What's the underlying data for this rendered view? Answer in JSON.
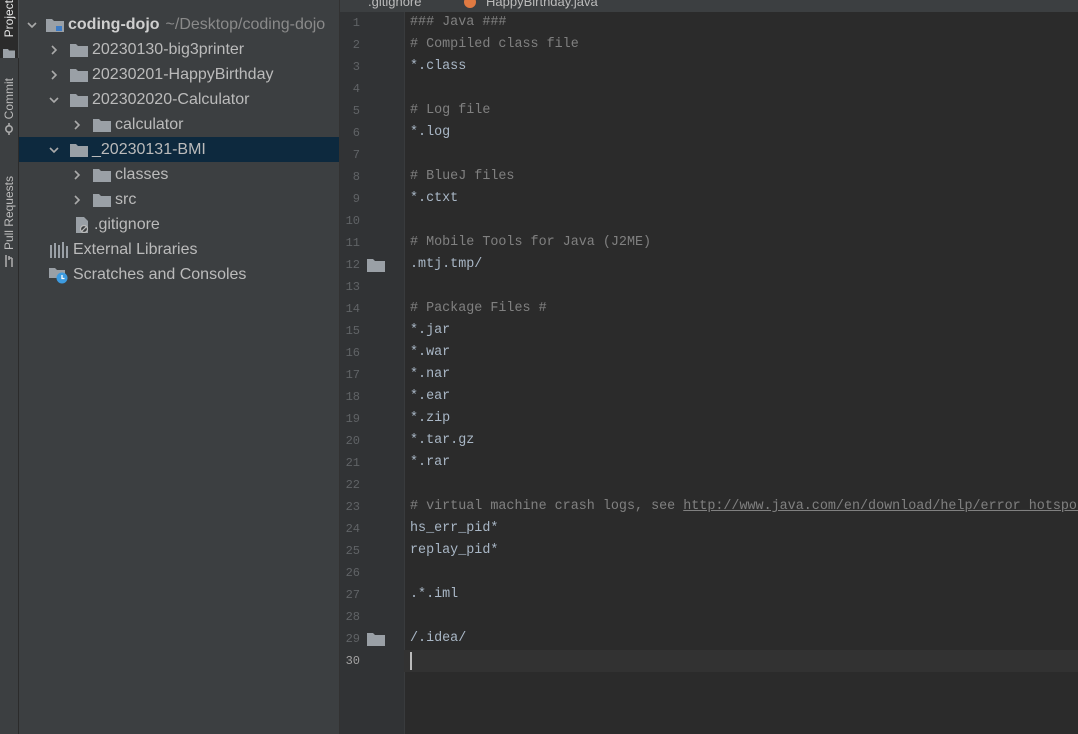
{
  "sidebar_tabs": {
    "project": "Project",
    "commit": "Commit",
    "pull_requests": "Pull Requests"
  },
  "project_tree": {
    "root": {
      "name": "coding-dojo",
      "path": "~/Desktop/coding-dojo"
    },
    "items": [
      {
        "label": "20230130-big3printer",
        "expanded": false,
        "type": "folder"
      },
      {
        "label": "20230201-HappyBirthday",
        "expanded": false,
        "type": "folder"
      },
      {
        "label": "202302020-Calculator",
        "expanded": true,
        "type": "folder"
      },
      {
        "label": "calculator",
        "expanded": false,
        "type": "folder"
      },
      {
        "label": "_20230131-BMI",
        "expanded": true,
        "type": "folder",
        "selected": true
      },
      {
        "label": "classes",
        "expanded": false,
        "type": "folder"
      },
      {
        "label": "src",
        "expanded": false,
        "type": "folder"
      },
      {
        "label": ".gitignore",
        "type": "file"
      },
      {
        "label": "External Libraries",
        "type": "library"
      },
      {
        "label": "Scratches and Consoles",
        "type": "scratches"
      }
    ]
  },
  "editor_tabs": [
    {
      "label": ".gitignore",
      "active": true
    },
    {
      "label": "HappyBirthday.java",
      "active": false
    }
  ],
  "code_lines": [
    {
      "n": "1",
      "text": "### Java ###",
      "kind": "comment"
    },
    {
      "n": "2",
      "text": "# Compiled class file",
      "kind": "comment"
    },
    {
      "n": "3",
      "text": "*.class",
      "kind": "code"
    },
    {
      "n": "4",
      "text": "",
      "kind": "code"
    },
    {
      "n": "5",
      "text": "# Log file",
      "kind": "comment"
    },
    {
      "n": "6",
      "text": "*.log",
      "kind": "code"
    },
    {
      "n": "7",
      "text": "",
      "kind": "code"
    },
    {
      "n": "8",
      "text": "# BlueJ files",
      "kind": "comment"
    },
    {
      "n": "9",
      "text": "*.ctxt",
      "kind": "code"
    },
    {
      "n": "10",
      "text": "",
      "kind": "code"
    },
    {
      "n": "11",
      "text": "# Mobile Tools for Java (J2ME)",
      "kind": "comment"
    },
    {
      "n": "12",
      "text": ".mtj.tmp/",
      "kind": "code",
      "folder_icon": true
    },
    {
      "n": "13",
      "text": "",
      "kind": "code"
    },
    {
      "n": "14",
      "text": "# Package Files #",
      "kind": "comment"
    },
    {
      "n": "15",
      "text": "*.jar",
      "kind": "code"
    },
    {
      "n": "16",
      "text": "*.war",
      "kind": "code"
    },
    {
      "n": "17",
      "text": "*.nar",
      "kind": "code"
    },
    {
      "n": "18",
      "text": "*.ear",
      "kind": "code"
    },
    {
      "n": "19",
      "text": "*.zip",
      "kind": "code"
    },
    {
      "n": "20",
      "text": "*.tar.gz",
      "kind": "code"
    },
    {
      "n": "21",
      "text": "*.rar",
      "kind": "code"
    },
    {
      "n": "22",
      "text": "",
      "kind": "code"
    },
    {
      "n": "23",
      "text": "# virtual machine crash logs, see ",
      "kind": "comment",
      "link": "http://www.java.com/en/download/help/error_hotspot.xml"
    },
    {
      "n": "24",
      "text": "hs_err_pid*",
      "kind": "code"
    },
    {
      "n": "25",
      "text": "replay_pid*",
      "kind": "code"
    },
    {
      "n": "26",
      "text": "",
      "kind": "code"
    },
    {
      "n": "27",
      "text": ".*.iml",
      "kind": "code"
    },
    {
      "n": "28",
      "text": "",
      "kind": "code"
    },
    {
      "n": "29",
      "text": "/.idea/",
      "kind": "code",
      "folder_icon": true
    },
    {
      "n": "30",
      "text": "",
      "kind": "code",
      "current": true
    }
  ],
  "colors": {
    "editor_bg": "#2b2b2b",
    "panel_bg": "#3c3f41",
    "selection": "#0d293e",
    "comment": "#808080",
    "code": "#a9b7c6",
    "tab_accent": "#4a88c7"
  }
}
